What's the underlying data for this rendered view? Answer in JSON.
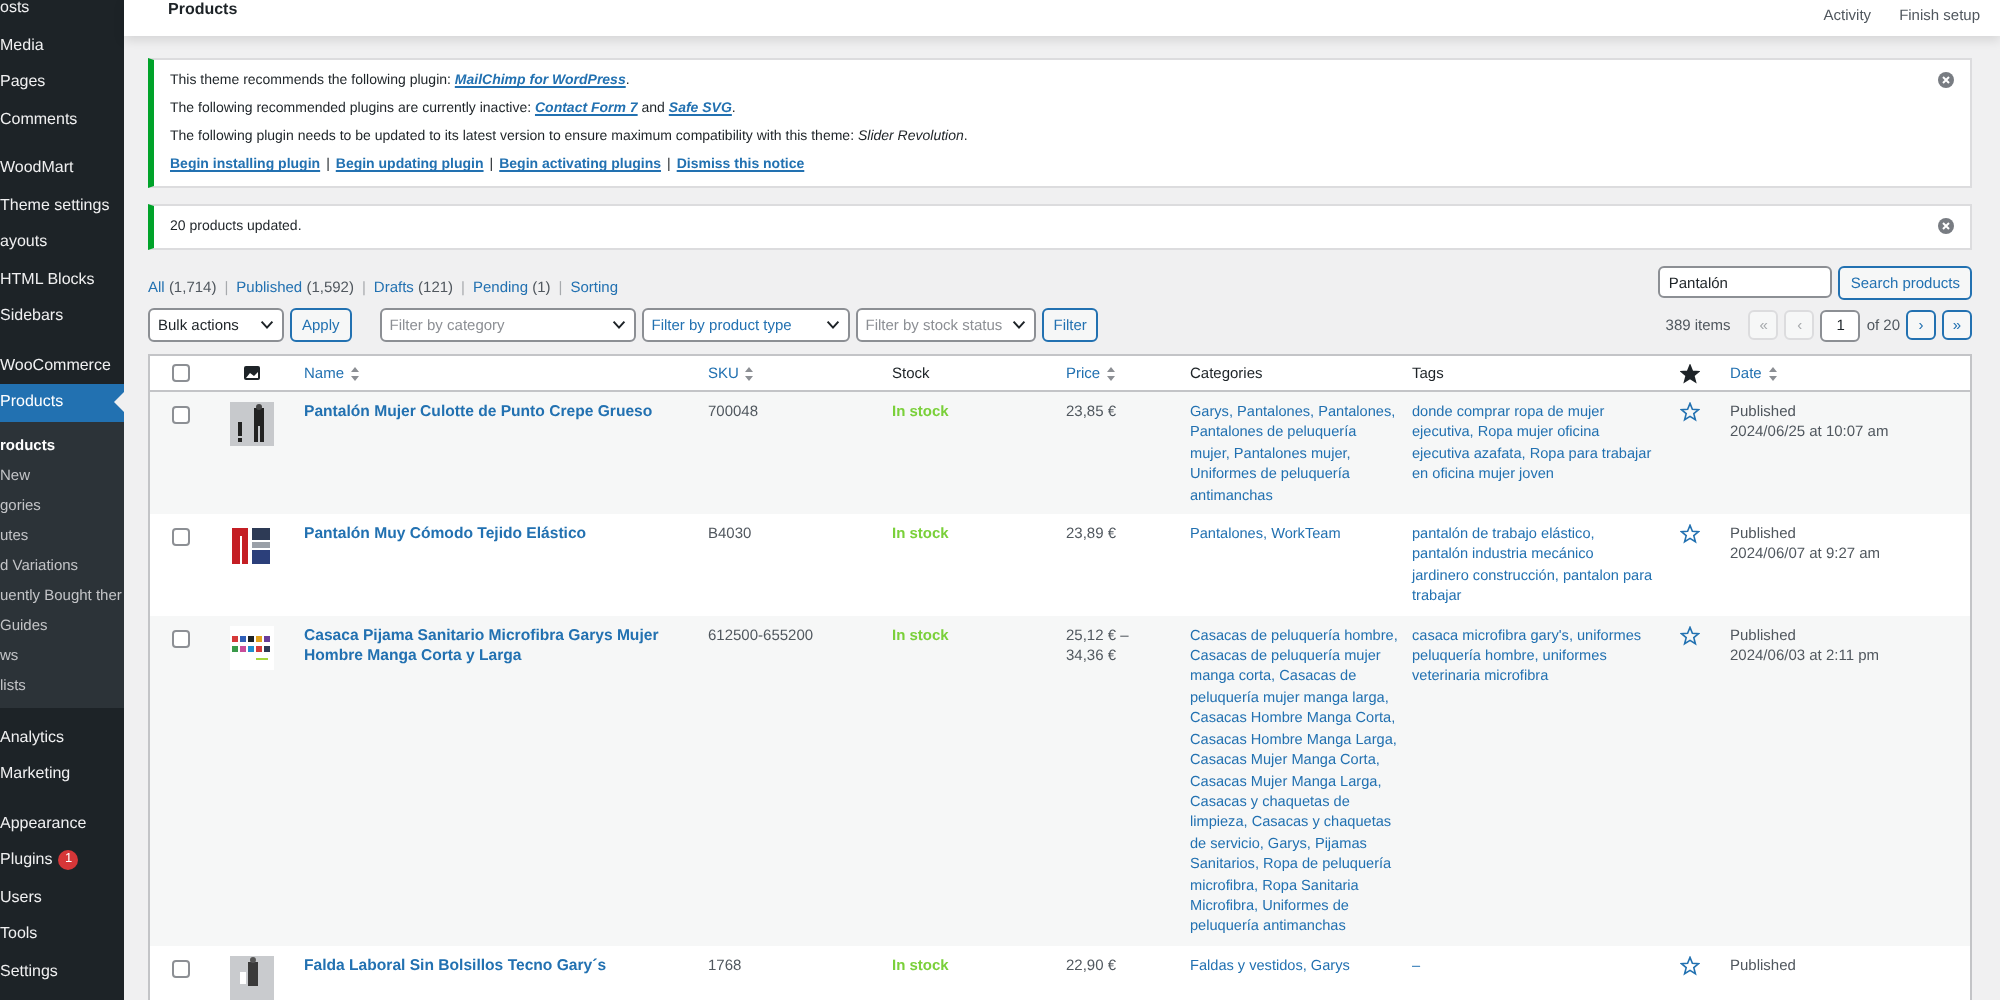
{
  "sidebar": {
    "sections": [
      [
        {
          "label": "osts",
          "selected": false
        },
        {
          "label": "Media",
          "selected": false
        },
        {
          "label": "Pages",
          "selected": false
        },
        {
          "label": "Comments",
          "selected": false
        }
      ],
      [
        {
          "label": "WoodMart",
          "selected": false
        },
        {
          "label": "Theme settings",
          "selected": false
        },
        {
          "label": "ayouts",
          "selected": false
        },
        {
          "label": "HTML Blocks",
          "selected": false
        },
        {
          "label": "Sidebars",
          "selected": false
        }
      ],
      [
        {
          "label": "WooCommerce",
          "selected": false
        },
        {
          "label": "Products",
          "selected": true,
          "children": [
            {
              "label": "roducts",
              "selected": true
            },
            {
              "label": "New",
              "selected": false
            },
            {
              "label": "gories",
              "selected": false
            },
            {
              "label": "utes",
              "selected": false
            },
            {
              "label": "d Variations",
              "selected": false
            },
            {
              "label": "uently Bought ther",
              "selected": false
            },
            {
              "label": "Guides",
              "selected": false
            },
            {
              "label": "ws",
              "selected": false
            },
            {
              "label": "lists",
              "selected": false
            }
          ]
        }
      ],
      [
        {
          "label": "Analytics",
          "selected": false
        },
        {
          "label": "Marketing",
          "selected": false
        }
      ],
      [
        {
          "label": "Appearance",
          "selected": false
        },
        {
          "label": "Plugins",
          "selected": false,
          "badge": "1"
        },
        {
          "label": "Users",
          "selected": false
        },
        {
          "label": "Tools",
          "selected": false
        },
        {
          "label": "Settings",
          "selected": false
        }
      ]
    ]
  },
  "header": {
    "title": "Products",
    "actions": [
      "Activity",
      "Finish setup"
    ]
  },
  "notices": [
    {
      "lines": [
        [
          {
            "kind": "text",
            "text": "This theme recommends the following plugin: "
          },
          {
            "kind": "link",
            "text": "MailChimp for WordPress"
          },
          {
            "kind": "text",
            "text": "."
          }
        ],
        [
          {
            "kind": "text",
            "text": "The following recommended plugins are currently inactive: "
          },
          {
            "kind": "link",
            "text": "Contact Form 7"
          },
          {
            "kind": "text",
            "text": " and "
          },
          {
            "kind": "link",
            "text": "Safe SVG"
          },
          {
            "kind": "text",
            "text": "."
          }
        ],
        [
          {
            "kind": "text",
            "text": "The following plugin needs to be updated to its latest version to ensure maximum compatibility with this theme: *Slider Revolution*."
          }
        ]
      ],
      "actions": [
        {
          "kind": "link",
          "text": "Begin installing plugin"
        },
        {
          "kind": "sep",
          "text": "|"
        },
        {
          "kind": "link",
          "text": "Begin updating plugin"
        },
        {
          "kind": "sep",
          "text": "|"
        },
        {
          "kind": "link",
          "text": "Begin activating plugins"
        },
        {
          "kind": "sep",
          "text": "|"
        },
        {
          "kind": "link",
          "text": "Dismiss this notice"
        }
      ]
    },
    {
      "lines": [
        [
          {
            "kind": "text",
            "text": "20 products updated."
          }
        ]
      ]
    }
  ],
  "status_filters": [
    {
      "kind": "link",
      "label": "All",
      "count": "(1,714)"
    },
    {
      "kind": "sep",
      "label": "|"
    },
    {
      "kind": "link",
      "label": "Published",
      "count": "(1,592)"
    },
    {
      "kind": "sep",
      "label": "|"
    },
    {
      "kind": "link",
      "label": "Drafts",
      "count": "(121)"
    },
    {
      "kind": "sep",
      "label": "|"
    },
    {
      "kind": "link",
      "label": "Pending",
      "count": "(1)"
    },
    {
      "kind": "sep",
      "label": "|"
    },
    {
      "kind": "link",
      "label": "Sorting"
    }
  ],
  "search": {
    "value": "Pantalón",
    "button": "Search products"
  },
  "toolbar": {
    "bulk": "Bulk actions",
    "apply": "Apply",
    "filters": [
      {
        "placeholder": "Filter by category",
        "focused": false
      },
      {
        "placeholder": "Filter by product type",
        "focused": true
      },
      {
        "placeholder": "Filter by stock status",
        "focused": false
      }
    ],
    "filter_button": "Filter"
  },
  "pagination": {
    "items": "389 items",
    "page": "1",
    "of": "of 20",
    "first": "«",
    "prev": "‹",
    "next": "›",
    "last": "»"
  },
  "table": {
    "header_checked": false,
    "columns": [
      {
        "label": "Name",
        "sortable": true
      },
      {
        "label": "SKU",
        "sortable": true
      },
      {
        "label": "Stock",
        "sortable": false
      },
      {
        "label": "Price",
        "sortable": true
      },
      {
        "label": "Categories",
        "sortable": false
      },
      {
        "label": "Tags",
        "sortable": false
      }
    ],
    "date_column": "Date",
    "rows": [
      {
        "checked": false,
        "name": "Pantalón Mujer Culotte de Punto Crepe Grueso",
        "sku": "700048",
        "stock": "In stock",
        "price": "23,85 €",
        "categories": "Garys, Pantalones, Pantalones, Pantalones de peluquería mujer, Pantalones mujer, Uniformes de peluquería antimanchas",
        "tags": "donde comprar ropa de mujer ejecutiva, Ropa mujer oficina ejecutiva azafata, Ropa para trabajar en oficina mujer joven",
        "featured": false,
        "status": "Published",
        "date": "2024/06/25 at 10:07 am"
      },
      {
        "checked": false,
        "name": "Pantalón Muy Cómodo Tejido Elástico",
        "sku": "B4030",
        "stock": "In stock",
        "price": "23,89 €",
        "categories": "Pantalones, WorkTeam",
        "tags": "pantalón de trabajo elástico, pantalón industria mecánico jardinero construcción, pantalon para trabajar",
        "featured": false,
        "status": "Published",
        "date": "2024/06/07 at 9:27 am"
      },
      {
        "checked": false,
        "name": "Casaca Pijama Sanitario Microfibra Garys Mujer Hombre Manga Corta y Larga",
        "sku": "612500-655200",
        "stock": "In stock",
        "price": "25,12 € – 34,36 €",
        "categories": "Casacas de peluquería hombre, Casacas de peluquería mujer manga corta, Casacas de peluquería mujer manga larga, Casacas Hombre Manga Corta, Casacas Hombre Manga Larga, Casacas Mujer Manga Corta, Casacas Mujer Manga Larga, Casacas y chaquetas de limpieza, Casacas y chaquetas de servicio, Garys, Pijamas Sanitarios, Ropa de peluquería microfibra, Ropa Sanitaria Microfibra, Uniformes de peluquería antimanchas",
        "tags": "casaca microfibra gary's, uniformes peluquería hombre, uniformes veterinaria microfibra",
        "featured": false,
        "status": "Published",
        "date": "2024/06/03 at 2:11 pm"
      },
      {
        "checked": false,
        "name": "Falda Laboral Sin Bolsillos Tecno Gary´s",
        "sku": "1768",
        "stock": "In stock",
        "price": "22,90 €",
        "categories": "Faldas y vestidos, Garys",
        "tags": "–",
        "featured": false,
        "status": "Published"
      }
    ]
  }
}
